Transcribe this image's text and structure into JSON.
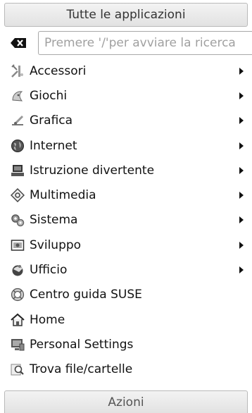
{
  "header": {
    "title": "Tutte le applicazioni"
  },
  "search": {
    "placeholder": "Premere '/'per avviare la ricerca"
  },
  "items": [
    {
      "label": "Accessori",
      "icon": "accessories-icon",
      "submenu": true
    },
    {
      "label": "Giochi",
      "icon": "games-icon",
      "submenu": true
    },
    {
      "label": "Grafica",
      "icon": "graphics-icon",
      "submenu": true
    },
    {
      "label": "Internet",
      "icon": "internet-globe-icon",
      "submenu": true
    },
    {
      "label": "Istruzione divertente",
      "icon": "education-icon",
      "submenu": true
    },
    {
      "label": "Multimedia",
      "icon": "multimedia-icon",
      "submenu": true
    },
    {
      "label": "Sistema",
      "icon": "system-gears-icon",
      "submenu": true
    },
    {
      "label": "Sviluppo",
      "icon": "development-icon",
      "submenu": true
    },
    {
      "label": "Ufficio",
      "icon": "office-icon",
      "submenu": true
    },
    {
      "label": "Centro guida SUSE",
      "icon": "help-center-icon",
      "submenu": false
    },
    {
      "label": "Home",
      "icon": "home-icon",
      "submenu": false
    },
    {
      "label": "Personal Settings",
      "icon": "personal-settings-icon",
      "submenu": false
    },
    {
      "label": "Trova file/cartelle",
      "icon": "find-files-icon",
      "submenu": false
    }
  ],
  "footer": {
    "title": "Azioni"
  }
}
